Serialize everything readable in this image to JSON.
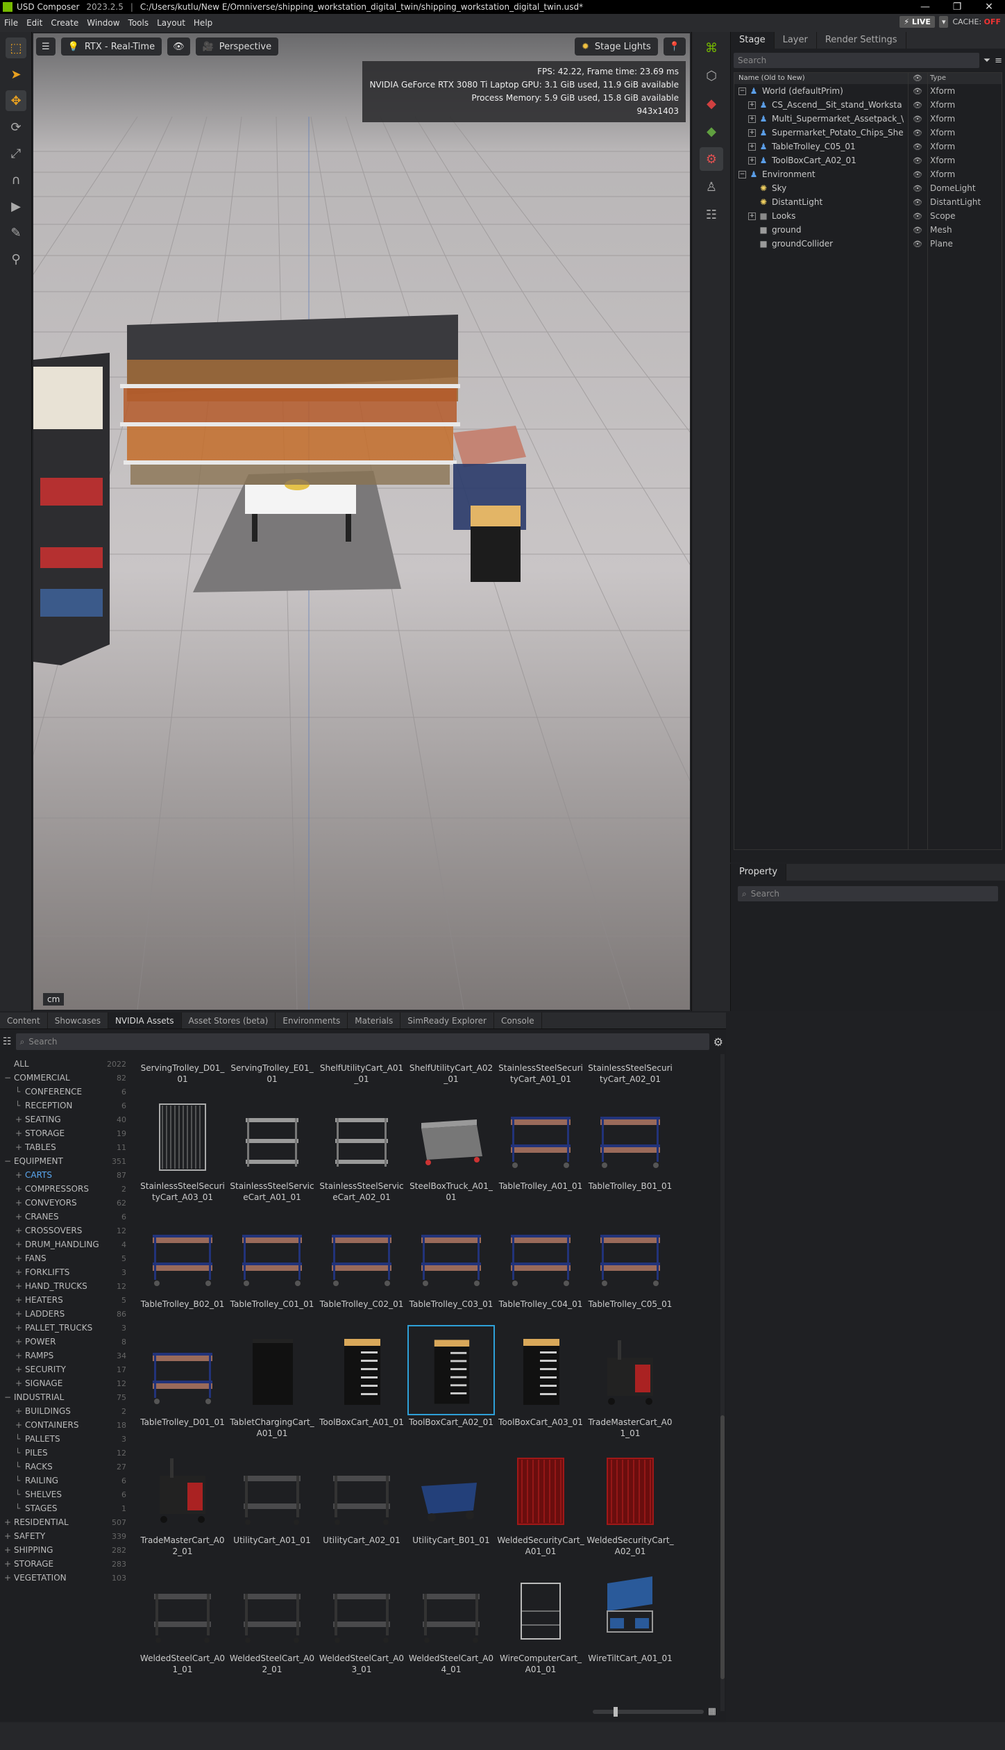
{
  "titlebar": {
    "app": "USD Composer",
    "version": "2023.2.5",
    "path": "C:/Users/kutlu/New E/Omniverse/shipping_workstation_digital_twin/shipping_workstation_digital_twin.usd*"
  },
  "menu": [
    "File",
    "Edit",
    "Create",
    "Window",
    "Tools",
    "Layout",
    "Help"
  ],
  "live": {
    "label": "LIVE",
    "cache_label": "CACHE:",
    "cache_state": "OFF"
  },
  "viewport": {
    "render_mode": "RTX - Real-Time",
    "camera": "Perspective",
    "lights": "Stage Lights",
    "stats": [
      "FPS: 42.22, Frame time: 23.69 ms",
      "NVIDIA GeForce RTX 3080 Ti Laptop GPU: 3.1 GiB used, 11.9 GiB available",
      "Process Memory: 5.9 GiB used, 15.8 GiB available",
      "943x1403"
    ],
    "unit": "cm"
  },
  "stage": {
    "tabs": [
      "Stage",
      "Layer",
      "Render Settings"
    ],
    "search_placeholder": "Search",
    "col_name": "Name (Old to New)",
    "col_type": "Type",
    "rows": [
      {
        "name": "World (defaultPrim)",
        "type": "Xform",
        "indent": 0,
        "expander": "−",
        "icon": "xform"
      },
      {
        "name": "CS_Ascend__Sit_stand_Worksta",
        "type": "Xform",
        "indent": 1,
        "expander": "+",
        "icon": "xform"
      },
      {
        "name": "Multi_Supermarket_Assetpack_\\",
        "type": "Xform",
        "indent": 1,
        "expander": "+",
        "icon": "xform"
      },
      {
        "name": "Supermarket_Potato_Chips_She",
        "type": "Xform",
        "indent": 1,
        "expander": "+",
        "icon": "xform"
      },
      {
        "name": "TableTrolley_C05_01",
        "type": "Xform",
        "indent": 1,
        "expander": "+",
        "icon": "xform"
      },
      {
        "name": "ToolBoxCart_A02_01",
        "type": "Xform",
        "indent": 1,
        "expander": "+",
        "icon": "xform"
      },
      {
        "name": "Environment",
        "type": "Xform",
        "indent": 0,
        "expander": "−",
        "icon": "xform"
      },
      {
        "name": "Sky",
        "type": "DomeLight",
        "indent": 1,
        "expander": "",
        "icon": "light"
      },
      {
        "name": "DistantLight",
        "type": "DistantLight",
        "indent": 1,
        "expander": "",
        "icon": "light"
      },
      {
        "name": "Looks",
        "type": "Scope",
        "indent": 1,
        "expander": "+",
        "icon": "scope"
      },
      {
        "name": "ground",
        "type": "Mesh",
        "indent": 1,
        "expander": "",
        "icon": "mesh"
      },
      {
        "name": "groundCollider",
        "type": "Plane",
        "indent": 1,
        "expander": "",
        "icon": "mesh"
      }
    ]
  },
  "property": {
    "tab": "Property",
    "search_placeholder": "Search"
  },
  "bottom": {
    "tabs": [
      "Content",
      "Showcases",
      "NVIDIA Assets",
      "Asset Stores (beta)",
      "Environments",
      "Materials",
      "SimReady Explorer",
      "Console"
    ],
    "search_placeholder": "Search",
    "categories": [
      {
        "label": "ALL",
        "count": "2022",
        "indent": 0,
        "prefix": ""
      },
      {
        "label": "COMMERCIAL",
        "count": "82",
        "indent": 0,
        "prefix": "−"
      },
      {
        "label": "CONFERENCE",
        "count": "6",
        "indent": 1,
        "prefix": ""
      },
      {
        "label": "RECEPTION",
        "count": "6",
        "indent": 1,
        "prefix": ""
      },
      {
        "label": "SEATING",
        "count": "40",
        "indent": 1,
        "prefix": "+"
      },
      {
        "label": "STORAGE",
        "count": "19",
        "indent": 1,
        "prefix": "+"
      },
      {
        "label": "TABLES",
        "count": "11",
        "indent": 1,
        "prefix": "+"
      },
      {
        "label": "EQUIPMENT",
        "count": "351",
        "indent": 0,
        "prefix": "−"
      },
      {
        "label": "CARTS",
        "count": "87",
        "indent": 1,
        "prefix": "+",
        "active": true
      },
      {
        "label": "COMPRESSORS",
        "count": "2",
        "indent": 1,
        "prefix": "+"
      },
      {
        "label": "CONVEYORS",
        "count": "62",
        "indent": 1,
        "prefix": "+"
      },
      {
        "label": "CRANES",
        "count": "6",
        "indent": 1,
        "prefix": "+"
      },
      {
        "label": "CROSSOVERS",
        "count": "12",
        "indent": 1,
        "prefix": "+"
      },
      {
        "label": "DRUM_HANDLING",
        "count": "4",
        "indent": 1,
        "prefix": "+"
      },
      {
        "label": "FANS",
        "count": "5",
        "indent": 1,
        "prefix": "+"
      },
      {
        "label": "FORKLIFTS",
        "count": "3",
        "indent": 1,
        "prefix": "+"
      },
      {
        "label": "HAND_TRUCKS",
        "count": "12",
        "indent": 1,
        "prefix": "+"
      },
      {
        "label": "HEATERS",
        "count": "5",
        "indent": 1,
        "prefix": "+"
      },
      {
        "label": "LADDERS",
        "count": "86",
        "indent": 1,
        "prefix": "+"
      },
      {
        "label": "PALLET_TRUCKS",
        "count": "3",
        "indent": 1,
        "prefix": "+"
      },
      {
        "label": "POWER",
        "count": "8",
        "indent": 1,
        "prefix": "+"
      },
      {
        "label": "RAMPS",
        "count": "34",
        "indent": 1,
        "prefix": "+"
      },
      {
        "label": "SECURITY",
        "count": "17",
        "indent": 1,
        "prefix": "+"
      },
      {
        "label": "SIGNAGE",
        "count": "12",
        "indent": 1,
        "prefix": "+"
      },
      {
        "label": "INDUSTRIAL",
        "count": "75",
        "indent": 0,
        "prefix": "−"
      },
      {
        "label": "BUILDINGS",
        "count": "2",
        "indent": 1,
        "prefix": "+"
      },
      {
        "label": "CONTAINERS",
        "count": "18",
        "indent": 1,
        "prefix": "+"
      },
      {
        "label": "PALLETS",
        "count": "3",
        "indent": 1,
        "prefix": ""
      },
      {
        "label": "PILES",
        "count": "12",
        "indent": 1,
        "prefix": ""
      },
      {
        "label": "RACKS",
        "count": "27",
        "indent": 1,
        "prefix": ""
      },
      {
        "label": "RAILING",
        "count": "6",
        "indent": 1,
        "prefix": ""
      },
      {
        "label": "SHELVES",
        "count": "6",
        "indent": 1,
        "prefix": ""
      },
      {
        "label": "STAGES",
        "count": "1",
        "indent": 1,
        "prefix": ""
      },
      {
        "label": "RESIDENTIAL",
        "count": "507",
        "indent": 0,
        "prefix": "+"
      },
      {
        "label": "SAFETY",
        "count": "339",
        "indent": 0,
        "prefix": "+"
      },
      {
        "label": "SHIPPING",
        "count": "282",
        "indent": 0,
        "prefix": "+"
      },
      {
        "label": "STORAGE",
        "count": "283",
        "indent": 0,
        "prefix": "+"
      },
      {
        "label": "VEGETATION",
        "count": "103",
        "indent": 0,
        "prefix": "+"
      }
    ],
    "assets": [
      {
        "label": "ServingTrolley_D01_01",
        "kind": "silver"
      },
      {
        "label": "ServingTrolley_E01_01",
        "kind": "silver"
      },
      {
        "label": "ShelfUtilityCart_A01_01",
        "kind": "dark"
      },
      {
        "label": "ShelfUtilityCart_A02_01",
        "kind": "dark"
      },
      {
        "label": "StainlessSteelSecurityCart_A01_01",
        "kind": "cage"
      },
      {
        "label": "StainlessSteelSecurityCart_A02_01",
        "kind": "cage"
      },
      {
        "label": "StainlessSteelSecurityCart_A03_01",
        "kind": "cage"
      },
      {
        "label": "StainlessSteelServiceCart_A01_01",
        "kind": "silver"
      },
      {
        "label": "StainlessSteelServiceCart_A02_01",
        "kind": "silver"
      },
      {
        "label": "SteelBoxTruck_A01_01",
        "kind": "box"
      },
      {
        "label": "TableTrolley_A01_01",
        "kind": "trolley"
      },
      {
        "label": "TableTrolley_B01_01",
        "kind": "trolley"
      },
      {
        "label": "TableTrolley_B02_01",
        "kind": "trolley"
      },
      {
        "label": "TableTrolley_C01_01",
        "kind": "trolley"
      },
      {
        "label": "TableTrolley_C02_01",
        "kind": "trolley"
      },
      {
        "label": "TableTrolley_C03_01",
        "kind": "trolley"
      },
      {
        "label": "TableTrolley_C04_01",
        "kind": "trolley"
      },
      {
        "label": "TableTrolley_C05_01",
        "kind": "trolley"
      },
      {
        "label": "TableTrolley_D01_01",
        "kind": "trolley"
      },
      {
        "label": "TabletChargingCart_A01_01",
        "kind": "black"
      },
      {
        "label": "ToolBoxCart_A01_01",
        "kind": "toolbox"
      },
      {
        "label": "ToolBoxCart_A02_01",
        "kind": "toolbox",
        "selected": true
      },
      {
        "label": "ToolBoxCart_A03_01",
        "kind": "toolbox"
      },
      {
        "label": "TradeMasterCart_A01_01",
        "kind": "redcart"
      },
      {
        "label": "TradeMasterCart_A02_01",
        "kind": "redcart"
      },
      {
        "label": "UtilityCart_A01_01",
        "kind": "dark"
      },
      {
        "label": "UtilityCart_A02_01",
        "kind": "dark"
      },
      {
        "label": "UtilityCart_B01_01",
        "kind": "wagon"
      },
      {
        "label": "WeldedSecurityCart_A01_01",
        "kind": "redcage"
      },
      {
        "label": "WeldedSecurityCart_A02_01",
        "kind": "redcage"
      },
      {
        "label": "WeldedSteelCart_A01_01",
        "kind": "dark"
      },
      {
        "label": "WeldedSteelCart_A02_01",
        "kind": "dark"
      },
      {
        "label": "WeldedSteelCart_A03_01",
        "kind": "dark"
      },
      {
        "label": "WeldedSteelCart_A04_01",
        "kind": "dark"
      },
      {
        "label": "WireComputerCart_A01_01",
        "kind": "wire"
      },
      {
        "label": "WireTiltCart_A01_01",
        "kind": "tilt"
      }
    ]
  },
  "colors": {
    "accent": "#76b900",
    "selection": "#2ea0d8",
    "active_category": "#5aa7f0",
    "live_off": "#e33333"
  }
}
